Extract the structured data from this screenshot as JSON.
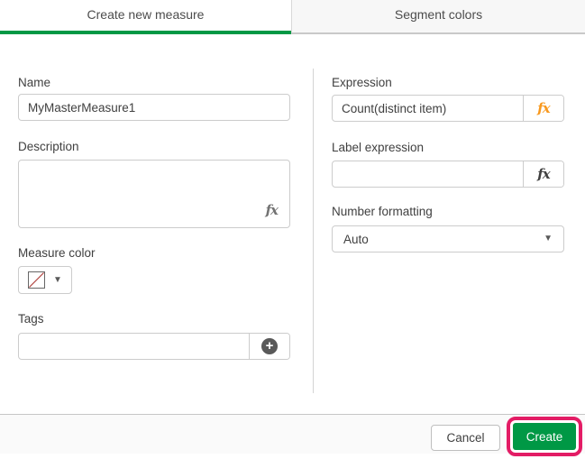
{
  "tabs": [
    {
      "label": "Create new measure",
      "active": true
    },
    {
      "label": "Segment colors",
      "active": false
    }
  ],
  "form": {
    "name": {
      "label": "Name",
      "value": "MyMasterMeasure1"
    },
    "description": {
      "label": "Description",
      "value": ""
    },
    "measure_color": {
      "label": "Measure color",
      "selected": "no-color"
    },
    "tags": {
      "label": "Tags",
      "value": ""
    },
    "expression": {
      "label": "Expression",
      "value": "Count(distinct item)"
    },
    "label_expression": {
      "label": "Label expression",
      "value": ""
    },
    "number_formatting": {
      "label": "Number formatting",
      "value": "Auto"
    }
  },
  "footer": {
    "cancel_label": "Cancel",
    "create_label": "Create"
  },
  "icons": {
    "fx": "fx",
    "plus": "+",
    "chevron_down": "▼"
  },
  "colors": {
    "accent_green": "#009845",
    "highlight_ring_magenta": "#e31c65",
    "fx_orange": "#f8981d",
    "no_color_diagonal_red": "#b0413e",
    "inactive_tab_bg": "#f7f7f7",
    "footer_bg": "#fafafa"
  }
}
